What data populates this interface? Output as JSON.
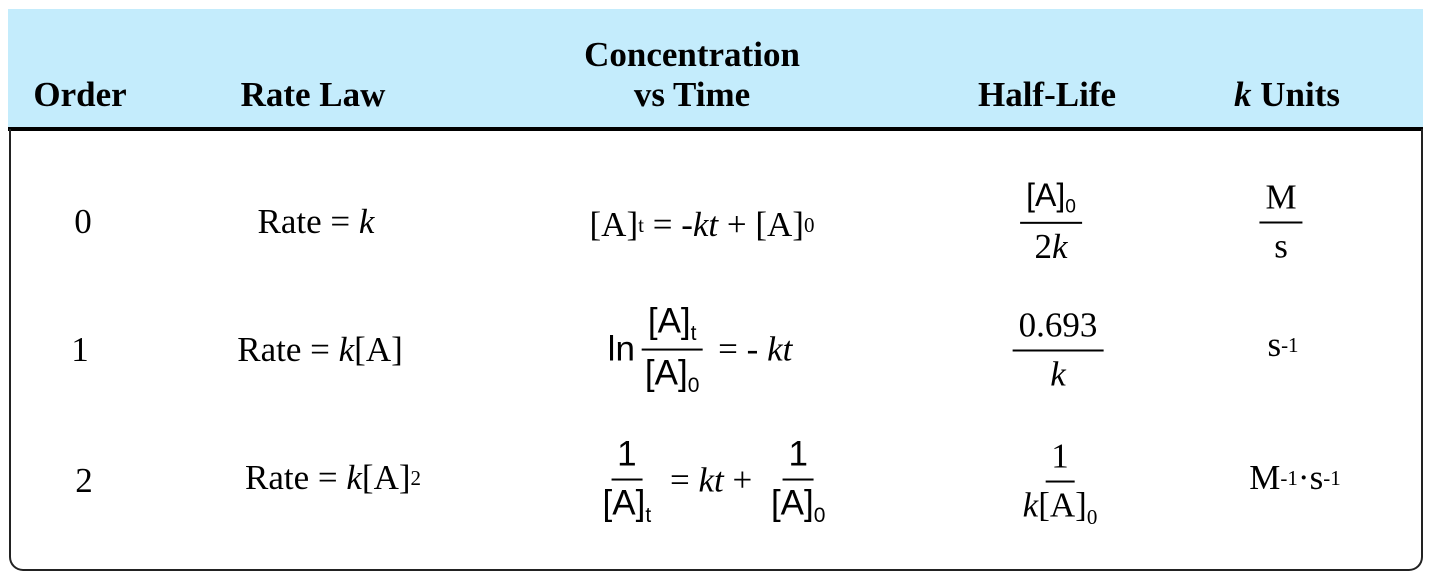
{
  "colors": {
    "header_bg": "#c4ecfc",
    "border": "#000000"
  },
  "headers": {
    "order": "Order",
    "rate_law": "Rate Law",
    "conc_line1": "Concentration",
    "conc_line2": "vs Time",
    "half_life": "Half-Life",
    "k_units_k": "k",
    "k_units_rest": " Units"
  },
  "rows": [
    {
      "order": "0",
      "rate_prefix": "Rate = ",
      "rate_k": "k",
      "rate_suffix": "",
      "conc": {
        "a": "[A]",
        "a_sub": "t",
        "eq": " = -",
        "kt": "kt",
        "plus": " + [A]",
        "b_sub": "0"
      },
      "half": {
        "num": "[A]",
        "num_sub": "0",
        "den_pre": "2",
        "den_k": "k"
      },
      "units": {
        "num": "M",
        "den": "s"
      }
    },
    {
      "order": "1",
      "rate_prefix": "Rate = ",
      "rate_k": "k",
      "rate_suffix": "[A]",
      "conc": {
        "ln": "ln",
        "num": "[A]",
        "num_sub": "t",
        "den": "[A]",
        "den_sub": "0",
        "eq": " = - ",
        "kt": "kt"
      },
      "half": {
        "num": "0.693",
        "den_k": "k"
      },
      "units": {
        "base": "s",
        "exp": "-1"
      }
    },
    {
      "order": "2",
      "rate_prefix": "Rate = ",
      "rate_k": "k",
      "rate_suffix": "[A]",
      "rate_exp": "2",
      "conc": {
        "num1": "1",
        "den1": "[A]",
        "den1_sub": "t",
        "eq": " = ",
        "kt": "kt",
        "plus": " + ",
        "num2": "1",
        "den2": "[A]",
        "den2_sub": "0"
      },
      "half": {
        "num": "1",
        "den_k": "k",
        "den": "[A]",
        "den_sub": "0"
      },
      "units": {
        "m": "M",
        "m_exp": "-1",
        "dot": "·",
        "s": "s",
        "s_exp": "-1"
      }
    }
  ]
}
